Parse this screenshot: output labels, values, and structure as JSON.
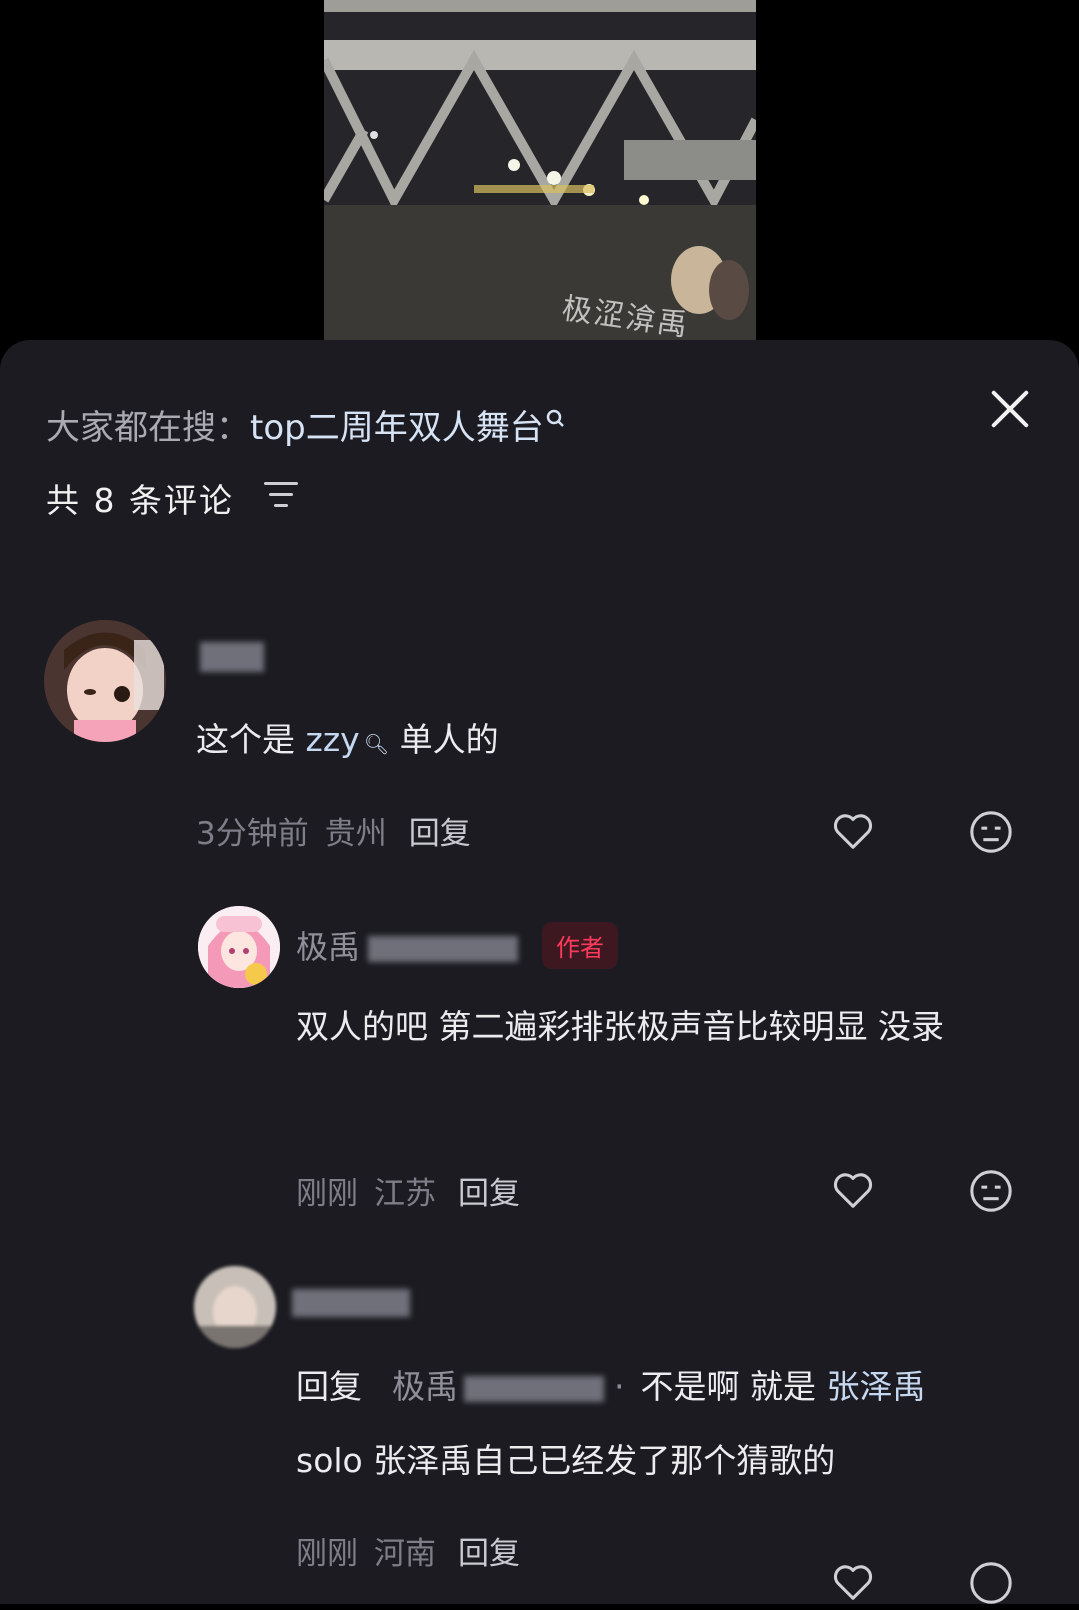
{
  "video": {
    "watermark": "极涩渰禹"
  },
  "panel": {
    "search_prefix": "大家都在搜：",
    "search_term": "top二周年双人舞台",
    "comment_count_text": "共 8 条评论"
  },
  "comments": [
    {
      "body_before": "这个是 ",
      "body_link": "zzy",
      "body_after": " 单人的",
      "time": "3分钟前",
      "location": "贵州",
      "reply_label": "回复"
    },
    {
      "nick_prefix": "极禹",
      "author_tag": "作者",
      "body": "双人的吧 第二遍彩排张极声音比较明显 没录",
      "time": "刚刚",
      "location": "江苏",
      "reply_label": "回复"
    },
    {
      "reply_prefix": "回复",
      "reply_target": "极禹",
      "body_part1": "不是啊 就是 ",
      "link1": "张泽禹",
      "body_part2": "solo 张泽禹自己已经发了那个猜歌的",
      "time": "刚刚",
      "location": "河南",
      "reply_label": "回复"
    }
  ]
}
